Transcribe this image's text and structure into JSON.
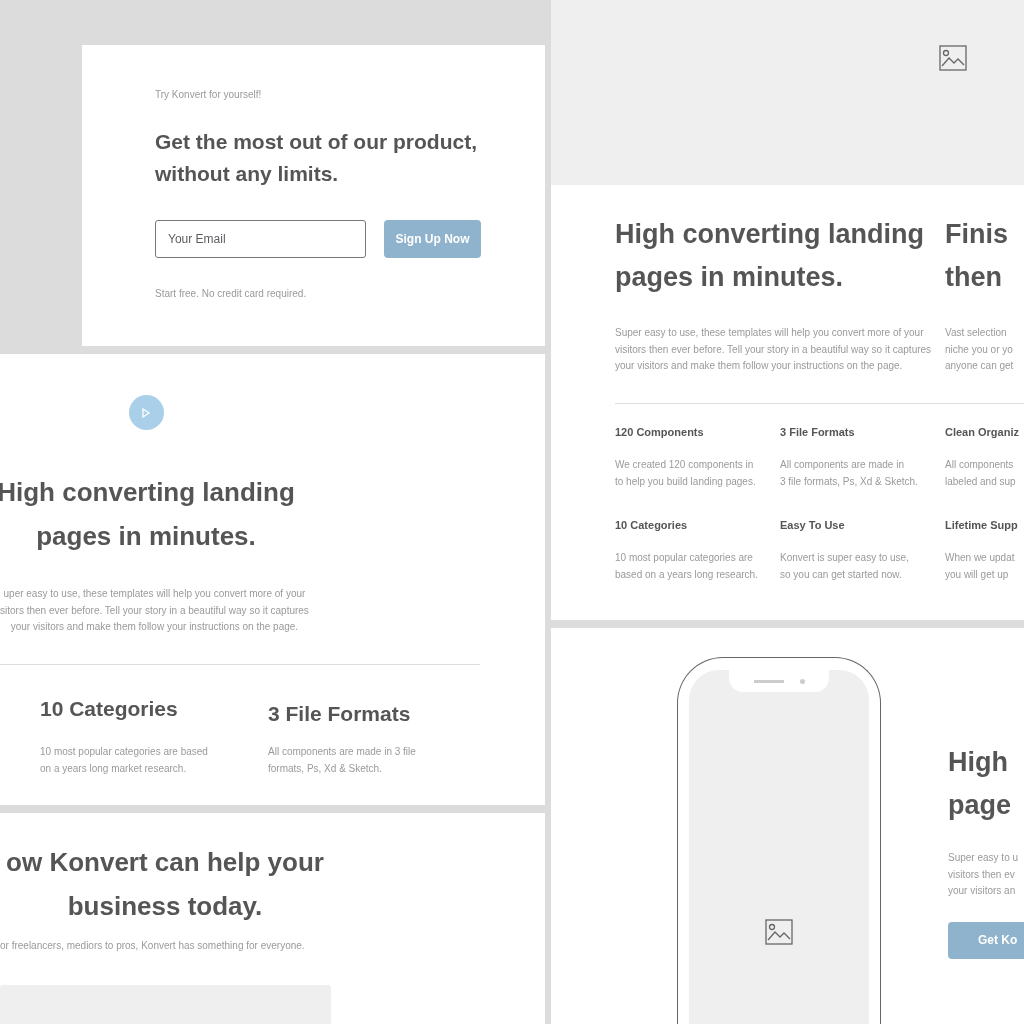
{
  "signup": {
    "eyebrow": "Try Konvert for yourself!",
    "title_lines": [
      "Get the most out of our product,",
      "without any limits."
    ],
    "email": {
      "placeholder": "Your Email"
    },
    "button": "Sign Up Now",
    "note": "Start free. No credit card required."
  },
  "video_section": {
    "title_lines": [
      "High converting landing",
      "pages in minutes."
    ],
    "body_lines": [
      "uper easy to use, these templates will help you convert more of your",
      "sitors then ever before. Tell your story in a beautiful way so it captures",
      "your visitors and make them follow your instructions on the page."
    ],
    "features": [
      {
        "title": "10 Categories",
        "body_lines": [
          "10 most popular categories are based",
          "on a years long market research."
        ]
      },
      {
        "title": "3 File Formats",
        "body_lines": [
          "All components are made in 3 file",
          "formats, Ps, Xd & Sketch."
        ]
      }
    ]
  },
  "help_section": {
    "title_lines": [
      "ow Konvert can help your",
      "business today."
    ],
    "subtitle": "or freelancers, mediors to pros, Konvert has something for everyone."
  },
  "features_section": {
    "columns": [
      {
        "title_lines": [
          "High converting landing",
          "pages in minutes."
        ],
        "body_lines": [
          "Super easy to use, these templates will help you convert more of your",
          "visitors then ever before. Tell your story in a beautiful way so it captures",
          "your visitors and make them follow your instructions on the page."
        ]
      },
      {
        "title_lines": [
          "Finis",
          "then"
        ],
        "body_lines": [
          "Vast selection",
          "niche you or yo",
          "anyone can get"
        ]
      }
    ],
    "features": [
      {
        "title": "120 Components",
        "body_lines": [
          "We created 120 components in",
          "to help you build landing pages."
        ]
      },
      {
        "title": "3 File Formats",
        "body_lines": [
          "All components are made in",
          "3 file formats, Ps, Xd & Sketch."
        ]
      },
      {
        "title": "Clean Organiz",
        "body_lines": [
          "All components",
          "labeled and sup"
        ]
      },
      {
        "title": "10 Categories",
        "body_lines": [
          "10 most popular categories are",
          "based on a years long research."
        ]
      },
      {
        "title": "Easy To Use",
        "body_lines": [
          "Konvert is super easy to use,",
          "so you can get started now."
        ]
      },
      {
        "title": "Lifetime Supp",
        "body_lines": [
          "When we updat",
          "you will get up"
        ]
      }
    ]
  },
  "phone_section": {
    "title_lines": [
      "High",
      "page"
    ],
    "body_lines": [
      "Super easy to u",
      "visitors then ev",
      "your visitors an"
    ],
    "button": "Get Ko"
  }
}
